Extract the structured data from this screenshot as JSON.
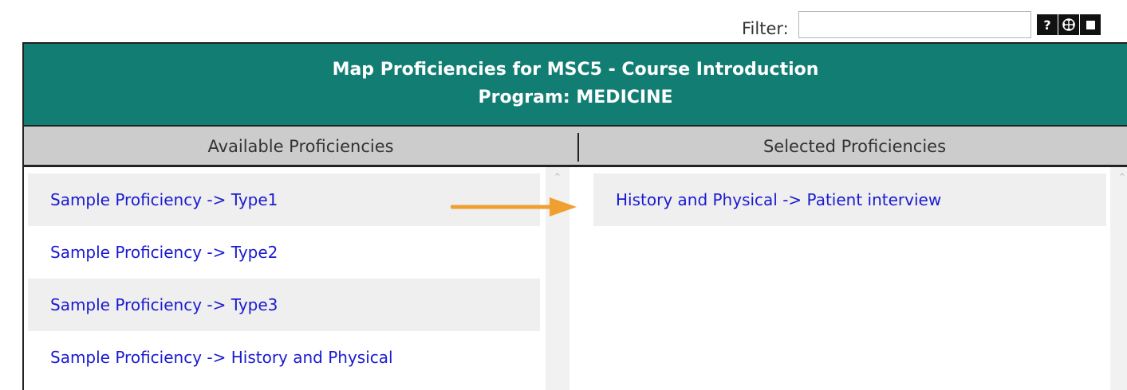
{
  "filter": {
    "label": "Filter:",
    "value": ""
  },
  "toolbar": {
    "help_glyph": "?",
    "help_icon": "help-icon",
    "move_icon": "move-icon",
    "maximize_icon": "maximize-icon"
  },
  "header": {
    "title": "Map Proficiencies for MSC5 - Course Introduction",
    "program": "Program: MEDICINE",
    "background_color": "#127d72"
  },
  "columns": {
    "available": "Available Proficiencies",
    "selected": "Selected Proficiencies"
  },
  "available_items": [
    "Sample Proficiency -> Type1",
    "Sample Proficiency -> Type2",
    "Sample Proficiency -> Type3",
    "Sample Proficiency -> History and Physical"
  ],
  "selected_items": [
    "History and Physical -> Patient interview"
  ],
  "colors": {
    "link": "#1a1ad0",
    "annotation_arrow": "#f0a030"
  },
  "icons": {
    "scroll_up": "chevron-up-icon",
    "annotation": "arrow-right-icon"
  }
}
